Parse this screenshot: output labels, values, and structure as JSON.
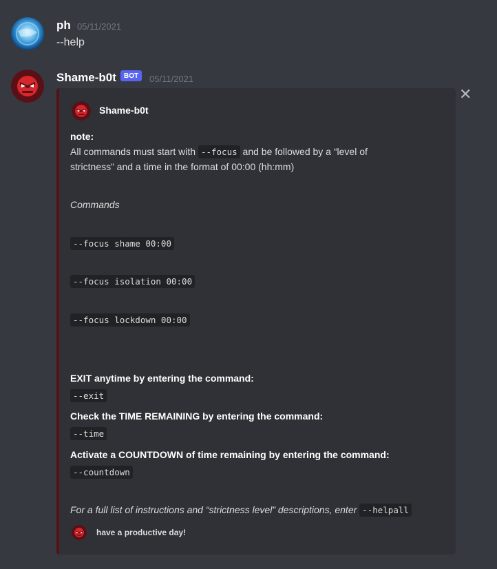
{
  "messages": [
    {
      "author": "ph",
      "timestamp": "05/11/2021",
      "content": "--help",
      "avatar_icon": "globe-avatar"
    },
    {
      "author": "Shame-b0t",
      "bot_tag": "BOT",
      "timestamp": "05/11/2021",
      "avatar_icon": "angry-face-avatar"
    }
  ],
  "embed": {
    "color": "#5b0f17",
    "author_name": "Shame-b0t",
    "note_title": "note:",
    "note_line1_prefix": "All commands must start with",
    "note_code": "--focus",
    "note_line1_suffix": "and be followed by a “level of",
    "note_line2": "strictness” and a time in the format of 00:00 (hh:mm)",
    "commands_heading": "Commands",
    "commands": [
      "--focus shame 00:00",
      "--focus isolation 00:00",
      "--focus lockdown 00:00"
    ],
    "exit_label": "EXIT anytime by entering the command:",
    "exit_code": "--exit",
    "time_label": "Check the TIME REMAINING by entering the command:",
    "time_code": "--time",
    "countdown_label": "Activate a COUNTDOWN of time remaining by entering the command:",
    "countdown_code": "--countdown",
    "full_list_text": "For a full list of instructions and “strictness level” descriptions, enter",
    "full_list_code": "--helpall",
    "footer_text": "have a productive day!"
  },
  "colors": {
    "background": "#36393f",
    "embed_bg": "#2f3136",
    "bot_tag": "#5865f2"
  }
}
